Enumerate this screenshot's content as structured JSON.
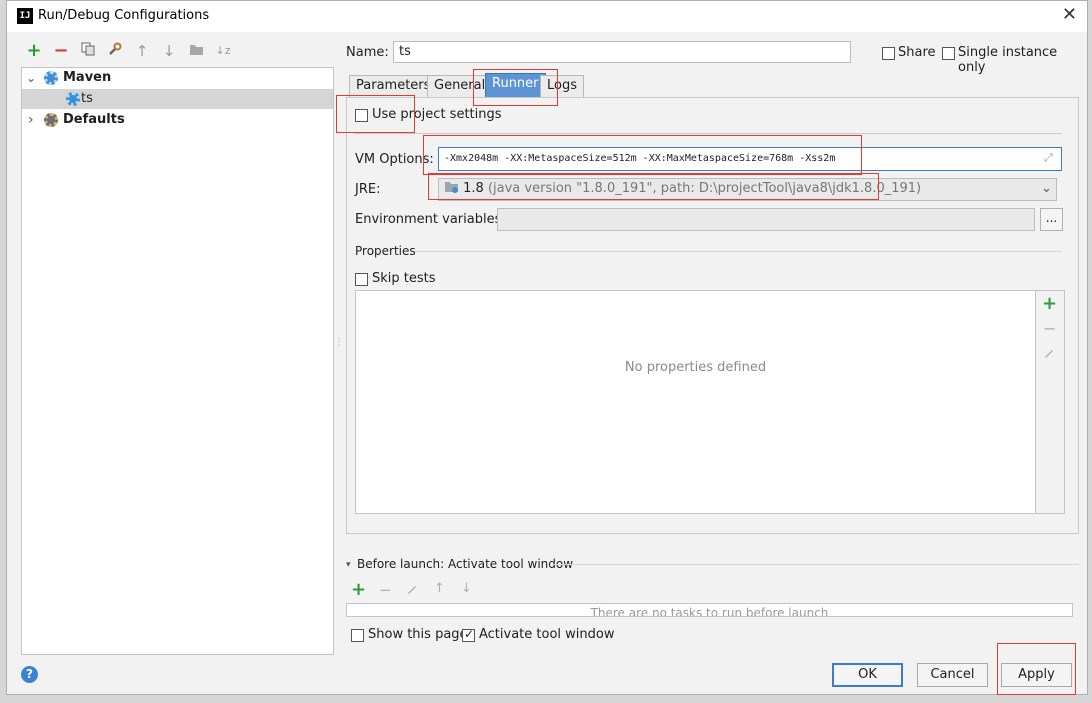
{
  "window": {
    "title": "Run/Debug Configurations",
    "app_icon": "IJ"
  },
  "toolbar": {
    "add": "+",
    "remove": "−",
    "copy": "copy-icon",
    "edit_defaults": "wrench-icon",
    "move_up": "↑",
    "move_down": "↓",
    "folder": "folder-icon",
    "sort": "↓z"
  },
  "tree": {
    "maven_label": "Maven",
    "ts_label": "ts",
    "defaults_label": "Defaults",
    "expanded_glyph": "⌄",
    "collapsed_glyph": "›"
  },
  "name": {
    "label": "Name:",
    "value": "ts"
  },
  "share": {
    "label": "Share",
    "checked": false
  },
  "single_instance": {
    "label": "Single instance only",
    "checked": false
  },
  "tabs": [
    {
      "label": "Parameters"
    },
    {
      "label": "General"
    },
    {
      "label": "Runner"
    },
    {
      "label": "Logs"
    }
  ],
  "runner": {
    "use_project_settings": {
      "label": "Use project settings",
      "checked": false
    },
    "vm_options": {
      "label": "VM Options:",
      "value": "-Xmx2048m -XX:MetaspaceSize=512m -XX:MaxMetaspaceSize=768m -Xss2m"
    },
    "jre": {
      "label": "JRE:",
      "version": "1.8",
      "detail": "(java version \"1.8.0_191\", path: D:\\projectTool\\java8\\jdk1.8.0_191)"
    },
    "env_vars": {
      "label": "Environment variables:",
      "value": "",
      "browse": "..."
    },
    "properties_label": "Properties",
    "skip_tests": {
      "label": "Skip tests",
      "checked": false
    },
    "no_properties": "No properties defined"
  },
  "before_launch": {
    "title": "Before launch: Activate tool window",
    "empty_text": "There are no tasks to run before launch",
    "show_page": {
      "label": "Show this page",
      "checked": false
    },
    "activate_tool_window": {
      "label": "Activate tool window",
      "checked": true
    }
  },
  "buttons": {
    "ok": "OK",
    "cancel": "Cancel",
    "apply": "Apply",
    "help": "?"
  },
  "colors": {
    "selected_tab": "#5d94d6",
    "highlight_box": "#e53935",
    "add_green": "#2e9a3a",
    "remove_red": "#d03b3b"
  }
}
